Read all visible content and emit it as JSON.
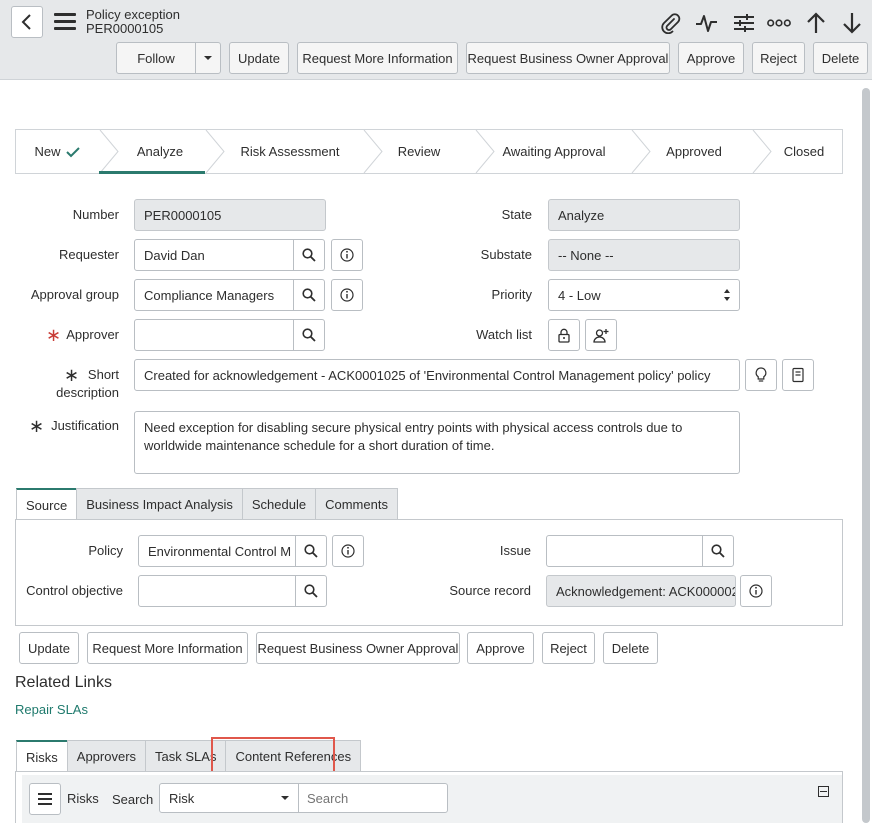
{
  "header": {
    "record_type": "Policy exception",
    "record_number": "PER0000105",
    "icons": [
      "chevron-left-icon",
      "hamburger-icon",
      "paperclip-icon",
      "activity-icon",
      "sliders-icon",
      "more-icon",
      "arrow-up-icon",
      "arrow-down-icon",
      "caret-down-icon"
    ],
    "follow_label": "Follow",
    "buttons": [
      "Update",
      "Request More Information",
      "Request Business Owner Approval",
      "Approve",
      "Reject",
      "Delete"
    ]
  },
  "flow": {
    "steps": [
      "New",
      "Analyze",
      "Risk Assessment",
      "Review",
      "Awaiting Approval",
      "Approved",
      "Closed"
    ],
    "completed": [
      "New"
    ],
    "current": "Analyze"
  },
  "form": {
    "number_label": "Number",
    "number_value": "PER0000105",
    "requester_label": "Requester",
    "requester_value": "David Dan",
    "approval_group_label": "Approval group",
    "approval_group_value": "Compliance Managers",
    "approver_label": "Approver",
    "approver_value": "",
    "required_marker": "∗",
    "state_label": "State",
    "state_value": "Analyze",
    "substate_label": "Substate",
    "substate_value": "-- None --",
    "priority_label": "Priority",
    "priority_value": "4 - Low",
    "watch_list_label": "Watch list",
    "short_desc_label_1": "Short",
    "short_desc_label_2": "description",
    "short_desc_value": "Created for acknowledgement - ACK0001025 of 'Environmental Control Management policy' policy",
    "justification_label": "Justification",
    "justification_value": "Need exception for disabling secure physical entry points with physical access controls due to worldwide maintenance schedule for a short duration of time."
  },
  "source_tabs": {
    "tabs": [
      "Source",
      "Business Impact Analysis",
      "Schedule",
      "Comments"
    ],
    "active": "Source",
    "policy_label": "Policy",
    "policy_value": "Environmental Control M",
    "control_objective_label": "Control objective",
    "control_objective_value": "",
    "issue_label": "Issue",
    "issue_value": "",
    "source_record_label": "Source record",
    "source_record_value": "Acknowledgement: ACK000002"
  },
  "bottom_buttons": [
    "Update",
    "Request More Information",
    "Request Business Owner Approval",
    "Approve",
    "Reject",
    "Delete"
  ],
  "related_links": {
    "title": "Related Links",
    "links": [
      "Repair SLAs"
    ]
  },
  "related_lists": {
    "tabs": [
      "Risks",
      "Approvers",
      "Task SLAs",
      "Content References"
    ],
    "active": "Risks",
    "highlighted": "Content References",
    "list_title": "Risks",
    "search_label": "Search",
    "search_field": "Risk",
    "search_placeholder": "Search"
  },
  "colors": {
    "accent": "#2b7a6e",
    "link": "#1f7a6d",
    "required": "#c83c36",
    "highlight": "#e0574b",
    "header_bg": "#e6e8ea"
  }
}
